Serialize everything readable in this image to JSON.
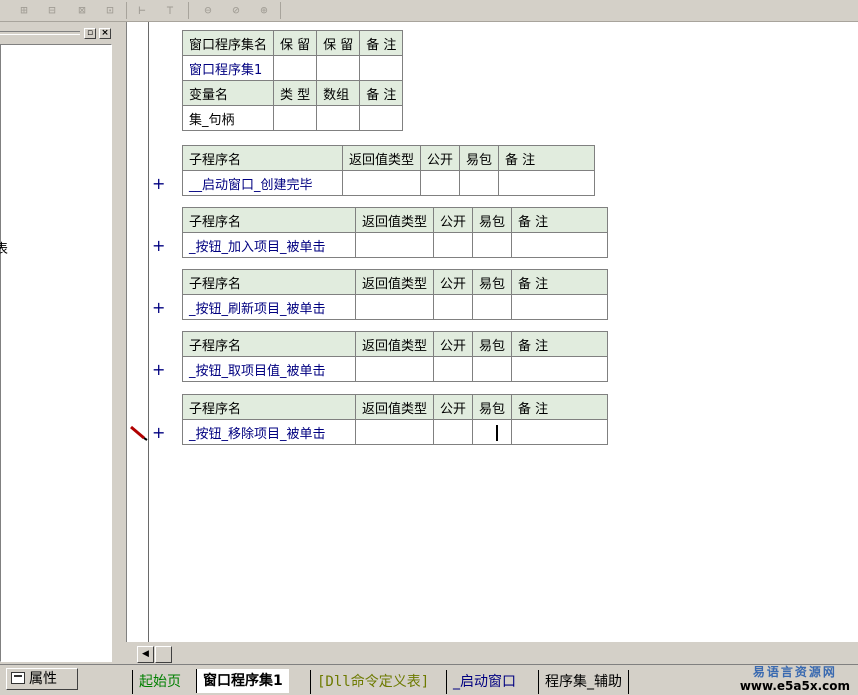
{
  "toolbar": {
    "buttons": [
      "align-left-icon",
      "align-center-icon",
      "align-top-icon",
      "align-middle-icon",
      "spacing-h-icon",
      "spacing-v-icon",
      "same-width-icon",
      "same-height-icon",
      "same-size-icon"
    ]
  },
  "left_panel": {
    "close_glyph": "×",
    "restore_glyph": "▫",
    "edge_char": "表"
  },
  "editor": {
    "program_set_table": {
      "headers": [
        "窗口程序集名",
        "保 留",
        "保 留",
        "备 注"
      ],
      "row": [
        "窗口程序集1",
        "",
        "",
        ""
      ],
      "var_headers": [
        "变量名",
        "类 型",
        "数组",
        "备 注"
      ],
      "var_row": [
        "集_句柄",
        "",
        "",
        ""
      ]
    },
    "sub_headers": [
      "子程序名",
      "返回值类型",
      "公开",
      "易包",
      "备 注"
    ],
    "plus_glyph": "+",
    "subs": [
      {
        "name": "__启动窗口_创建完毕"
      },
      {
        "name": "_按钮_加入项目_被单击"
      },
      {
        "name": "_按钮_刷新项目_被单击"
      },
      {
        "name": "_按钮_取项目值_被单击"
      },
      {
        "name": "_按钮_移除项目_被单击"
      }
    ]
  },
  "bottom": {
    "properties_label": "属性",
    "tabs": [
      {
        "label": "起始页",
        "active": false
      },
      {
        "label": "窗口程序集1",
        "active": true
      },
      {
        "label": "[Dll命令定义表]",
        "active": false
      },
      {
        "label": "_启动窗口",
        "active": false
      },
      {
        "label": "程序集_辅助",
        "active": false
      }
    ],
    "brand_cn": "易语言资源网",
    "brand_url": "www.e5a5x.com"
  },
  "colors": {
    "header_bg": "#e1ecde",
    "name_text": "#000080",
    "chrome": "#d4d0c8"
  }
}
